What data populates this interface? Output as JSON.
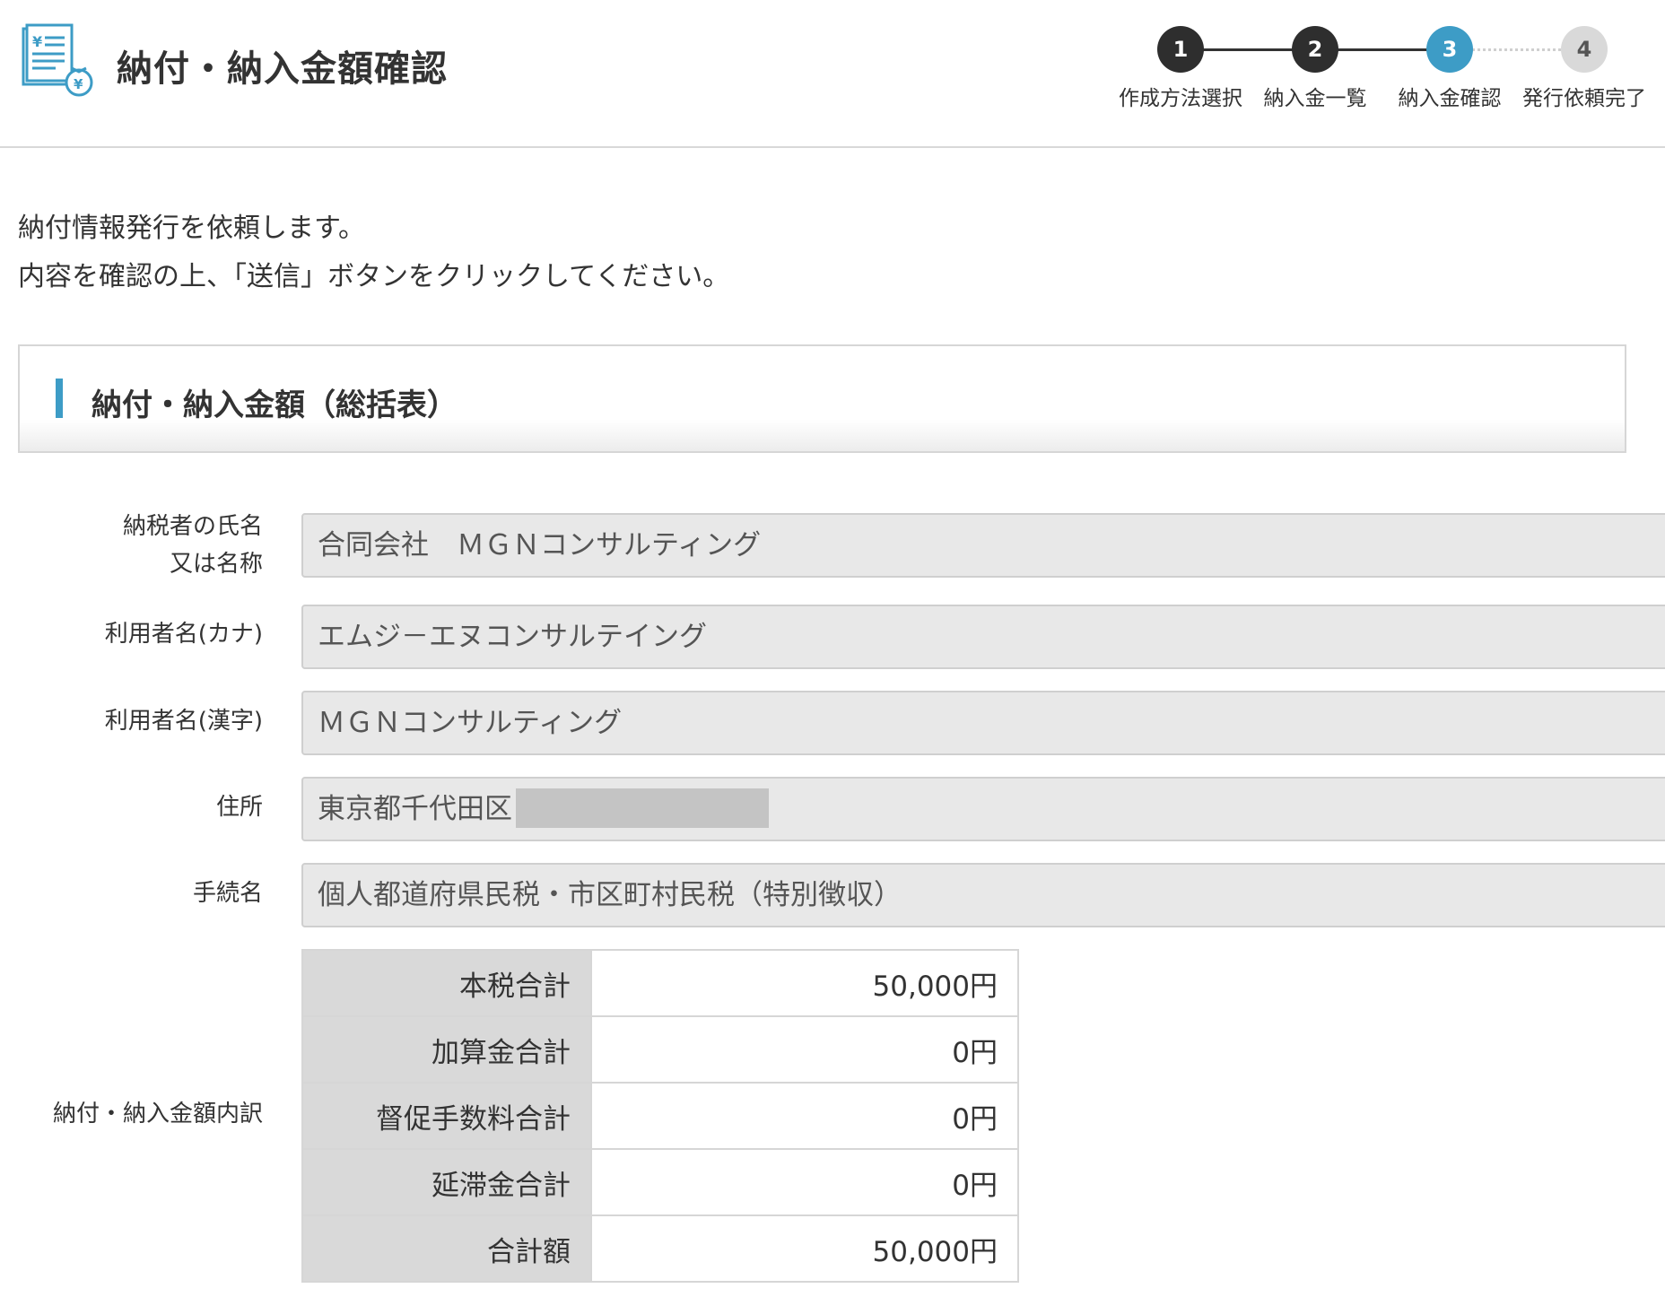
{
  "header": {
    "title": "納付・納入金額確認",
    "icon": "tax-document-icon"
  },
  "steps": [
    {
      "number": "1",
      "label": "作成方法選択",
      "state": "done"
    },
    {
      "number": "2",
      "label": "納入金一覧",
      "state": "done"
    },
    {
      "number": "3",
      "label": "納入金確認",
      "state": "active"
    },
    {
      "number": "4",
      "label": "発行依頼完了",
      "state": "todo"
    }
  ],
  "intro": {
    "line1": "納付情報発行を依頼します。",
    "line2": "内容を確認の上、「送信」ボタンをクリックしてください。"
  },
  "section": {
    "title": "納付・納入金額（総括表）"
  },
  "form": {
    "taxpayer_name": {
      "label_line1": "納税者の氏名",
      "label_line2": "又は名称",
      "value": "合同会社　ＭＧＮコンサルティング"
    },
    "user_kana": {
      "label": "利用者名(カナ)",
      "value": "エムジ－エヌコンサルテイング"
    },
    "user_kanji": {
      "label": "利用者名(漢字)",
      "value": "ＭＧＮコンサルティング"
    },
    "address": {
      "label": "住所",
      "value": "東京都千代田区"
    },
    "procedure": {
      "label": "手続名",
      "value": "個人都道府県民税・市区町村民税（特別徴収）"
    },
    "breakdown": {
      "label": "納付・納入金額内訳",
      "rows": [
        {
          "label": "本税合計",
          "value": "50,000円"
        },
        {
          "label": "加算金合計",
          "value": "0円"
        },
        {
          "label": "督促手数料合計",
          "value": "0円"
        },
        {
          "label": "延滞金合計",
          "value": "0円"
        },
        {
          "label": "合計額",
          "value": "50,000円"
        }
      ]
    }
  },
  "colors": {
    "accent": "#3d9cc6",
    "step_done": "#2e2e2e",
    "step_todo": "#d9d9d9",
    "field_bg": "#e8e8e8"
  }
}
